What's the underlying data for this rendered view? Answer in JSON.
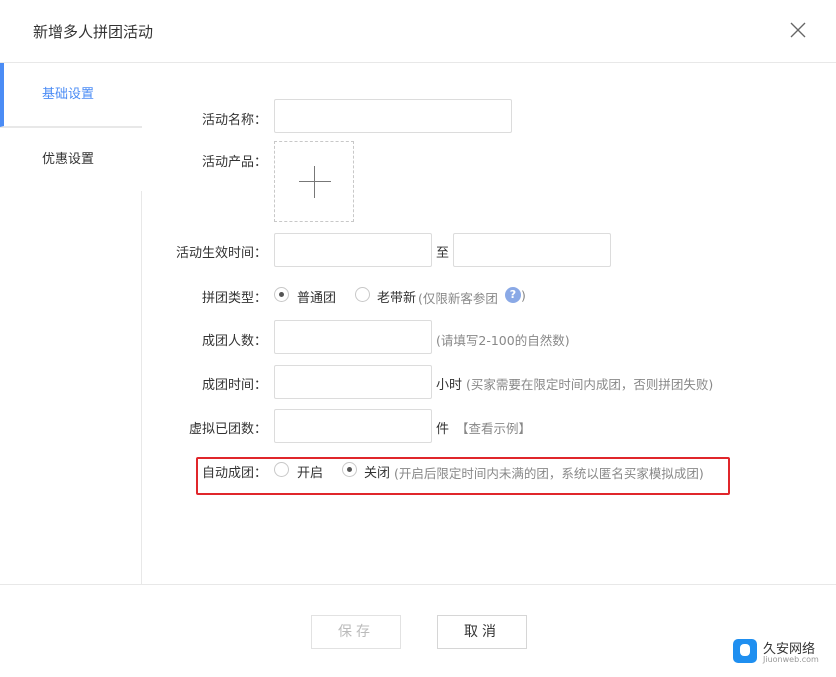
{
  "dialog": {
    "title": "新增多人拼团活动"
  },
  "sidebar": {
    "tabs": [
      {
        "label": "基础设置",
        "active": true
      },
      {
        "label": "优惠设置",
        "active": false
      }
    ]
  },
  "form": {
    "activity_name_label": "活动名称：",
    "activity_product_label": "活动产品：",
    "valid_time_label": "活动生效时间：",
    "valid_time_separator": "至",
    "group_type_label": "拼团类型：",
    "group_type_options": [
      "普通团",
      "老带新"
    ],
    "group_type_selected": "普通团",
    "group_type_hint": "(仅限新客参团",
    "group_type_hint_close": ")",
    "group_size_label": "成团人数：",
    "group_size_hint": "(请填写2-100的自然数)",
    "group_time_label": "成团时间：",
    "group_time_unit": "小时",
    "group_time_hint": "(买家需要在限定时间内成团，否则拼团失败)",
    "virtual_groups_label": "虚拟已团数：",
    "virtual_groups_unit": "件",
    "virtual_groups_link": "【查看示例】",
    "auto_group_label": "自动成团：",
    "auto_group_options": [
      "开启",
      "关闭"
    ],
    "auto_group_selected": "关闭",
    "auto_group_hint": "(开启后限定时间内未满的团，系统以匿名买家模拟成团)"
  },
  "footer": {
    "save_label": "保存",
    "cancel_label": "取消"
  },
  "watermark": {
    "title": "久安网络",
    "subtitle": "Jiuonweb.com"
  },
  "colors": {
    "accent": "#4b8cf5",
    "highlight": "#e0262b"
  },
  "icons": {
    "close": "close-icon",
    "upload": "plus-icon",
    "help": "question-circle-icon"
  }
}
